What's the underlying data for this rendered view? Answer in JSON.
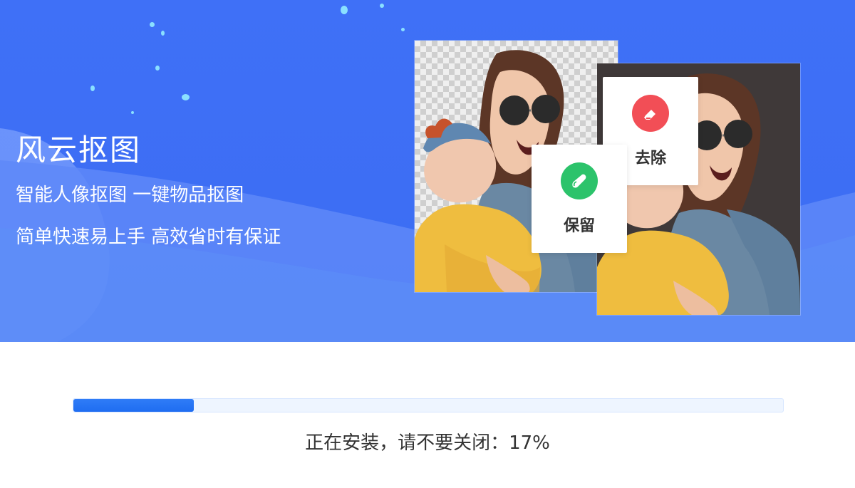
{
  "hero": {
    "title": "风云抠图",
    "line1": "智能人像抠图 一键物品抠图",
    "line2": "简单快速易上手 高效省时有保证"
  },
  "actions": {
    "keep_label": "保留",
    "remove_label": "去除",
    "keep_icon": "brush-icon",
    "remove_icon": "eraser-icon"
  },
  "install": {
    "status": "正在安装，请不要关闭：17%",
    "progress_percent": 17
  },
  "colors": {
    "primary_blue": "#3f70f7",
    "progress_blue": "#1f6df1",
    "keep_green": "#2cc36b",
    "remove_red": "#f24e56"
  }
}
